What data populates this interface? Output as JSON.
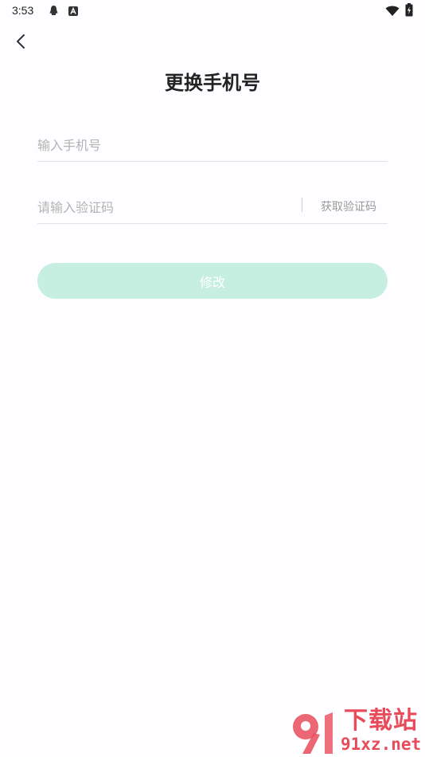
{
  "status_bar": {
    "time": "3:53"
  },
  "header": {
    "title": "更换手机号"
  },
  "form": {
    "phone_placeholder": "输入手机号",
    "code_placeholder": "请输入验证码",
    "get_code_label": "获取验证码",
    "submit_label": "修改"
  },
  "colors": {
    "accent_disabled": "#c6efe1",
    "watermark": "#e84c5b"
  },
  "watermark": {
    "title": "下载站",
    "url": "91xz.net"
  }
}
